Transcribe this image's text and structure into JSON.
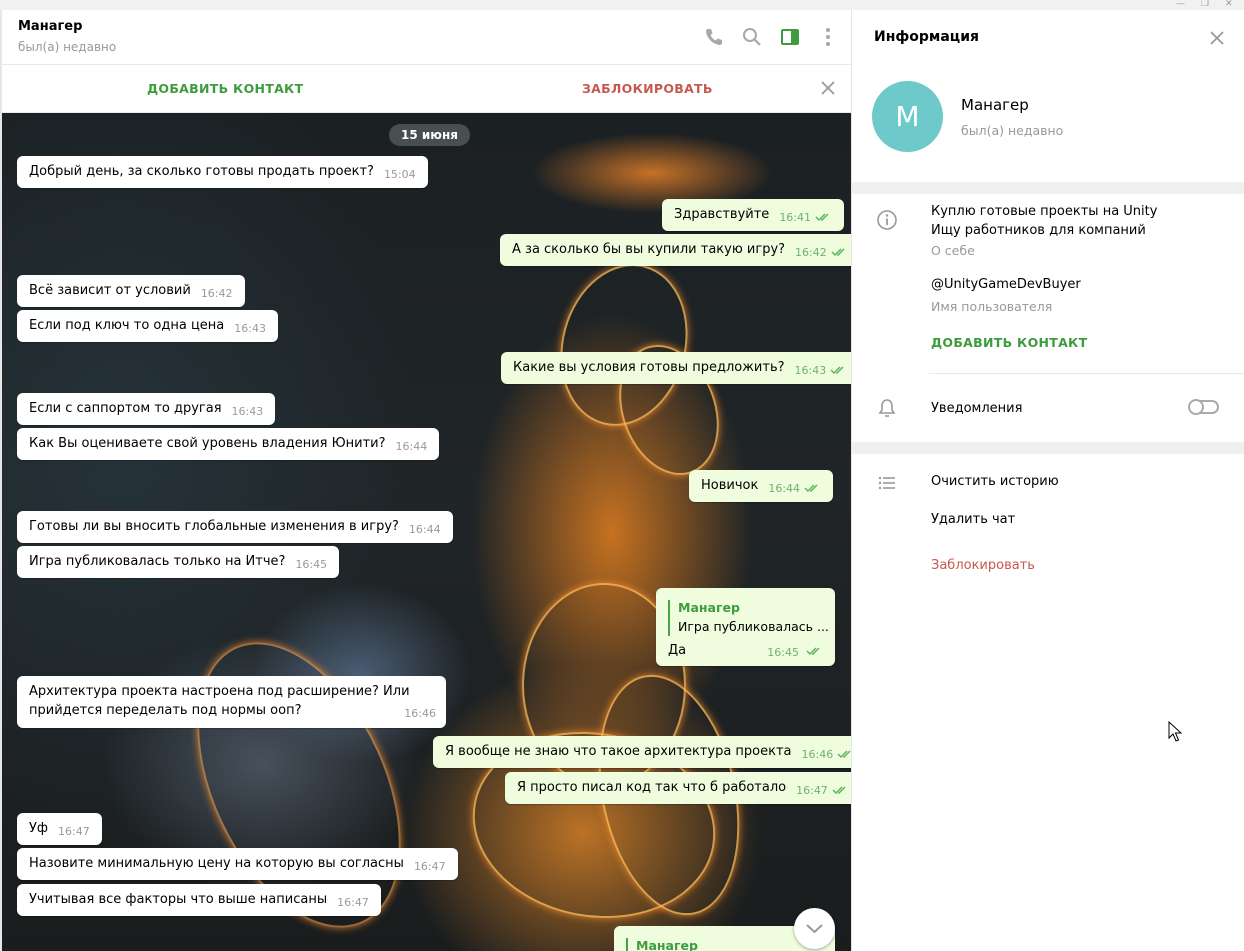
{
  "window": {
    "controls": [
      "—",
      "❐",
      "✕"
    ]
  },
  "chat": {
    "header": {
      "name": "Манагер",
      "status": "был(а) недавно"
    },
    "actions": {
      "add_contact": "ДОБАВИТЬ КОНТАКТ",
      "block": "ЗАБЛОКИРОВАТЬ"
    },
    "date": "15 июня",
    "messages": [
      {
        "text": "Добрый день, за сколько готовы продать проект?",
        "time": "15:04"
      },
      {
        "text": "Здравствуйте",
        "time": "16:41"
      },
      {
        "text": "А за сколько бы вы купили такую игру?",
        "time": "16:42"
      },
      {
        "text": "Всё зависит от условий",
        "time": "16:42"
      },
      {
        "text": "Если под ключ то одна цена",
        "time": "16:43"
      },
      {
        "text": "Какие вы условия готовы предложить?",
        "time": "16:43"
      },
      {
        "text": "Если с саппортом то другая",
        "time": "16:43"
      },
      {
        "text": "Как Вы оцениваете свой уровень владения Юнити?",
        "time": "16:44"
      },
      {
        "text": "Новичок",
        "time": "16:44"
      },
      {
        "text": "Готовы ли вы вносить глобальные изменения в игру?",
        "time": "16:44"
      },
      {
        "text": "Игра публиковалась только на Итче?",
        "time": "16:45"
      },
      {
        "reply_name": "Манагер",
        "reply_text": "Игра публиковалась ...",
        "text": "Да",
        "time": "16:45"
      },
      {
        "text": "Архитектура проекта настроена под расширение? Или прийдется переделать под нормы ооп?",
        "time": "16:46"
      },
      {
        "text": "Я вообще не знаю что такое архитектура проекта",
        "time": "16:46"
      },
      {
        "text": "Я просто писал код так что б работало",
        "time": "16:47"
      },
      {
        "text": "Уф",
        "time": "16:47"
      },
      {
        "text": "Назовите минимальную цену на которую вы согласны",
        "time": "16:47"
      },
      {
        "text": "Учитывая все факторы что выше написаны",
        "time": "16:47"
      },
      {
        "reply_name": "Манагер"
      }
    ]
  },
  "info": {
    "title": "Информация",
    "avatar_letter": "М",
    "name": "Манагер",
    "status": "был(а) недавно",
    "about": "Куплю готовые проекты на Unity Ищу работников для компаний",
    "about_label": "О себе",
    "username": "@UnityGameDevBuyer",
    "username_label": "Имя пользователя",
    "add_contact": "ДОБАВИТЬ КОНТАКТ",
    "notifications": "Уведомления",
    "notifications_on": false,
    "clear_history": "Очистить историю",
    "delete_chat": "Удалить чат",
    "block": "Заблокировать"
  },
  "colors": {
    "accent_green": "#3d9c3d",
    "danger_red": "#c65a4f",
    "out_bubble": "#effdde",
    "avatar": "#6ec9cb"
  }
}
